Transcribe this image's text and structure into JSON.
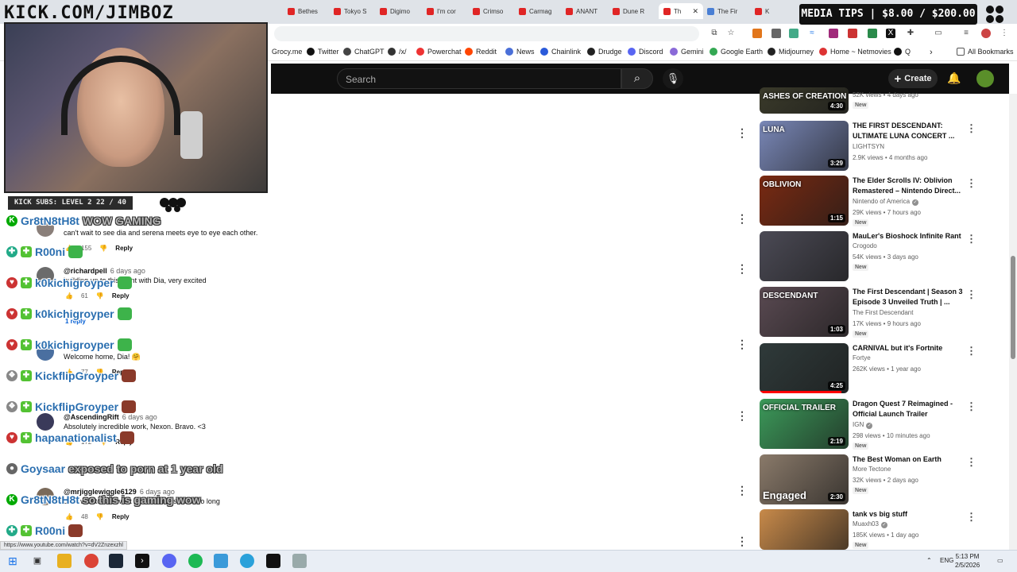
{
  "overlay": {
    "kick_title": "KICK.COM/JIMBOZ",
    "media_tips": "MEDIA TIPS | $8.00 / $200.00",
    "kick_subs": "KICK SUBS: LEVEL 2 22 / 40"
  },
  "browser": {
    "tabs": [
      {
        "label": "Bethes"
      },
      {
        "label": "Tokyo S"
      },
      {
        "label": "Digimo"
      },
      {
        "label": "I'm cor"
      },
      {
        "label": "Crimso"
      },
      {
        "label": "Carmag"
      },
      {
        "label": "ANANT"
      },
      {
        "label": "Dune R"
      },
      {
        "label": "Th"
      },
      {
        "label": "The Fir"
      },
      {
        "label": "K"
      }
    ],
    "bookmarks": [
      "Grocy.me",
      "Twitter",
      "ChatGPT",
      "/x/",
      "Powerchat",
      "Reddit",
      "News",
      "Chainlink",
      "Drudge",
      "Discord",
      "Gemini",
      "Google Earth",
      "Midjourney",
      "Home ~ Netmovies",
      "Q"
    ],
    "all_bookmarks": "All Bookmarks",
    "status_url": "https://www.youtube.com/watch?v=dV2Znzexzhl"
  },
  "youtube": {
    "search_placeholder": "Search",
    "create_label": "Create"
  },
  "comments": [
    {
      "handle": "",
      "age": "",
      "text": "can't wait to see dia and serena meets eye to eye each other.",
      "likes": "155",
      "reply": "Reply"
    },
    {
      "handle": "@richardpell",
      "age": "6 days ago",
      "text": "building up to this point with Dia, very excited",
      "likes": "61",
      "reply": "Reply",
      "replies": "1 reply"
    },
    {
      "handle": "",
      "age": "ago",
      "text": "Welcome home, Dia! 🤗",
      "likes": "77",
      "reply": "Reply"
    },
    {
      "handle": "@AscendingRift",
      "age": "6 days ago",
      "text": "Absolutely incredible work, Nexon. Bravo. <3",
      "likes": "172",
      "reply": "Reply"
    },
    {
      "handle": "@mrjigglewiggle6129",
      "age": "6 days ago",
      "text": "can't wait to see what Dia can do its been so long",
      "likes": "48",
      "reply": "Reply"
    }
  ],
  "chat": [
    {
      "user": "Gr8tN8tH8t",
      "msg": "WOW GAMING"
    },
    {
      "user": "R00ni",
      "msg": ""
    },
    {
      "user": "k0kichigroyper",
      "msg": ""
    },
    {
      "user": "k0kichigroyper",
      "msg": ""
    },
    {
      "user": "k0kichigroyper",
      "msg": ""
    },
    {
      "user": "KickflipGroyper",
      "msg": ""
    },
    {
      "user": "KickflipGroyper",
      "msg": ""
    },
    {
      "user": "hapanationalist",
      "msg": ""
    },
    {
      "user": "Goysaar",
      "msg": "exposed to porn at 1 year old"
    },
    {
      "user": "Gr8tN8tH8t",
      "msg": "so this is gaming wow"
    },
    {
      "user": "R00ni",
      "msg": ""
    }
  ],
  "sidebar": [
    {
      "title": "",
      "channel": "",
      "meta": "52K views • 4 days ago",
      "new": "New",
      "duration": "4:30",
      "thumb_label": "ASHES OF CREATION",
      "thumb_color": "#3a3a2a",
      "progress": 0
    },
    {
      "title": "THE FIRST DESCENDANT: ULTIMATE LUNA CONCERT ...",
      "channel": "LIGHTSYN",
      "meta": "2.9K views • 4 months ago",
      "new": "",
      "duration": "3:29",
      "thumb_label": "LUNA",
      "thumb_color": "#7a88b8",
      "progress": 0
    },
    {
      "title": "The Elder Scrolls IV: Oblivion Remastered – Nintendo Direct...",
      "channel": "Nintendo of America",
      "meta": "29K views • 7 hours ago",
      "new": "New",
      "duration": "1:15",
      "thumb_label": "OBLIVION",
      "thumb_color": "#7a2a12",
      "progress": 0
    },
    {
      "title": "MauLer's Bioshock Infinite Rant",
      "channel": "Crogodo",
      "meta": "54K views • 3 days ago",
      "new": "New",
      "duration": "",
      "thumb_label": "",
      "thumb_color": "#4b4a55",
      "progress": 0
    },
    {
      "title": "The First Descendant | Season 3 Episode 3 Unveiled Truth | ...",
      "channel": "The First Descendant",
      "meta": "17K views • 9 hours ago",
      "new": "New",
      "duration": "1:03",
      "thumb_label": "DESCENDANT",
      "thumb_color": "#5a4a52",
      "progress": 0
    },
    {
      "title": "CARNIVAL but it's Fortnite",
      "channel": "Fortye",
      "meta": "262K views • 1 year ago",
      "new": "",
      "duration": "4:25",
      "thumb_label": "",
      "thumb_color": "#2f3a3a",
      "progress": 0.92
    },
    {
      "title": "Dragon Quest 7 Reimagined - Official Launch Trailer",
      "channel": "IGN",
      "meta": "298 views • 10 minutes ago",
      "new": "New",
      "duration": "2:19",
      "thumb_label": "OFFICIAL TRAILER",
      "thumb_color": "#3c9a5a",
      "progress": 0
    },
    {
      "title": "The Best Woman on Earth",
      "channel": "More Tectone",
      "meta": "32K views • 2 days ago",
      "new": "New",
      "duration": "2:30",
      "thumb_label": "Engaged",
      "thumb_color": "#8a7a6a",
      "progress": 0
    },
    {
      "title": "tank vs big stuff",
      "channel": "Muaxh03",
      "meta": "185K views • 1 day ago",
      "new": "New",
      "duration": "",
      "thumb_label": "",
      "thumb_color": "#c88a4a",
      "progress": 0
    }
  ],
  "taskbar": {
    "lang": "ENG",
    "time": "5:13 PM",
    "date": "2/5/2026"
  }
}
